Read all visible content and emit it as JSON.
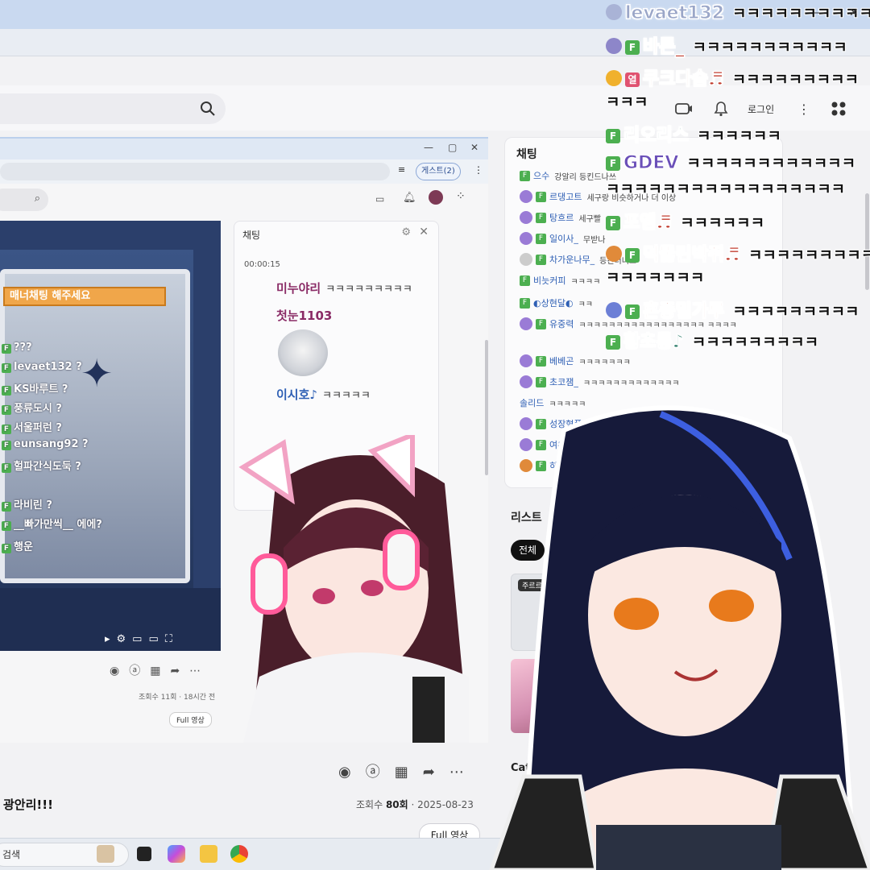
{
  "outer_header": {
    "login_label": "로그인",
    "more_label": "⋮"
  },
  "inner_window": {
    "guest_label": "게스트(2)",
    "banner": "매너채팅 해주세요",
    "video_chat": [
      {
        "name": "???",
        "text": ""
      },
      {
        "name": "levaet132",
        "text": "?"
      },
      {
        "name": "KS바루트",
        "text": "?"
      },
      {
        "name": "풍류도시",
        "text": "?"
      },
      {
        "name": "서울퍼런",
        "text": "?"
      },
      {
        "name": "eunsang92",
        "text": "?"
      },
      {
        "name": "헐파간식도둑",
        "text": "?"
      },
      {
        "name": "라비린",
        "text": "?"
      },
      {
        "name": "__빠가만씩__",
        "text": "에에?"
      },
      {
        "name": "행운",
        "text": ""
      }
    ],
    "chat_title": "채팅",
    "chat_timestamp": "00:00:15",
    "chat_lines": [
      {
        "name": "미누야리",
        "text": "ㅋㅋㅋㅋㅋㅋㅋㅋㅋ"
      },
      {
        "name": "첫눈1103",
        "text": ""
      },
      {
        "name": "이시호♪",
        "text": "ㅋㅋㅋㅋㅋ"
      }
    ],
    "views": "조회수 11회 · 18시간 전",
    "full_label": "Full 영상"
  },
  "right_chat": {
    "title": "채팅",
    "rows": [
      {
        "name": "으수",
        "text": "강알리 등킨드나쓰"
      },
      {
        "name": "르댕고트",
        "text": "세구랑 비슷하거나 더 이상"
      },
      {
        "name": "탕흐르",
        "text": "세구빨"
      },
      {
        "name": "일이사_",
        "text": "무받나"
      },
      {
        "name": "차가운나무_",
        "text": "등킨더너스"
      },
      {
        "name": "비늣커피",
        "text": "ㅋㅋㅋㅋ"
      },
      {
        "name": "◐상현달◐",
        "text": "ㅋㅋ"
      },
      {
        "name": "유중력",
        "text": "ㅋㅋㅋㅋㅋㅋㅋㅋㅋㅋㅋㅋㅋㅋㅋㅋㅋ ㅋㅋㅋㅋ"
      },
      {
        "name": "베베곤",
        "text": "ㅋㅋㅋㅋㅋㅋㅋ"
      },
      {
        "name": "초코잼_",
        "text": "ㅋㅋㅋㅋㅋㅋㅋㅋㅋㅋㅋㅋㅋ"
      },
      {
        "name": "솔리드",
        "text": "ㅋㅋㅋㅋㅋ"
      },
      {
        "name": "성장형폭도",
        "text": "ㅋ"
      },
      {
        "name": "여우굴",
        "text": ""
      },
      {
        "name": "히켄",
        "text": ""
      }
    ]
  },
  "list": {
    "title": "리스트",
    "chip_all": "전체",
    "thumb_label": "주르르",
    "catch_label": "Catch"
  },
  "video": {
    "title": "광안리!!!",
    "views_label": "조회수",
    "views_value": "80회",
    "date": "2025-08-23",
    "full_label": "Full 영상"
  },
  "taskbar": {
    "search_label": "검색"
  },
  "overlay_chat": [
    {
      "name": "levaet132",
      "text": "ㅋㅋㅋㅋㅋㅋㅋㅋㅋㅋㅋ",
      "color": "#9aa6c8"
    },
    {
      "name": "바른_",
      "text": "ㅋㅋㅋㅋㅋㅋㅋㅋㅋㅋㅋ",
      "color": "#c0392b"
    },
    {
      "name": "쿠크다슴♬",
      "text": "ㅋㅋㅋㅋㅋㅋㅋㅋㅋ",
      "color": "#c0392b",
      "cont": "ㅋㅋㅋ"
    },
    {
      "name": "리오리스",
      "text": "ㅋㅋㅋㅋㅋㅋ",
      "color": "#2e7d6b"
    },
    {
      "name": "GDEV",
      "text": "ㅋㅋㅋㅋㅋㅋㅋㅋㅋㅋㅋㅋ",
      "color": "#6a4fb8",
      "cont": "ㅋㅋㅋㅋㅋㅋㅋㅋㅋㅋㅋㅋㅋㅋㅋㅋㅋ"
    },
    {
      "name": "포엠♬",
      "text": "ㅋㅋㅋㅋㅋㅋ",
      "color": "#c0392b"
    },
    {
      "name": "덕뚫린박쥐♬",
      "text": "ㅋㅋㅋㅋㅋㅋㅋㅋㅋ",
      "color": "#c0392b",
      "cont": "ㅋㅋㅋㅋㅋㅋㅋ"
    },
    {
      "name": "혼종밀가루",
      "text": "ㅋㅋㅋㅋㅋㅋㅋㅋㅋ",
      "color": "#c0392b"
    },
    {
      "name": "황초롱♪",
      "text": "ㅋㅋㅋㅋㅋㅋㅋㅋㅋ",
      "color": "#2e7d6b"
    }
  ],
  "colors": {
    "fan_badge": "#4caf50",
    "hot_badge": "#e05270",
    "accent_blue": "#2e5fb4"
  }
}
